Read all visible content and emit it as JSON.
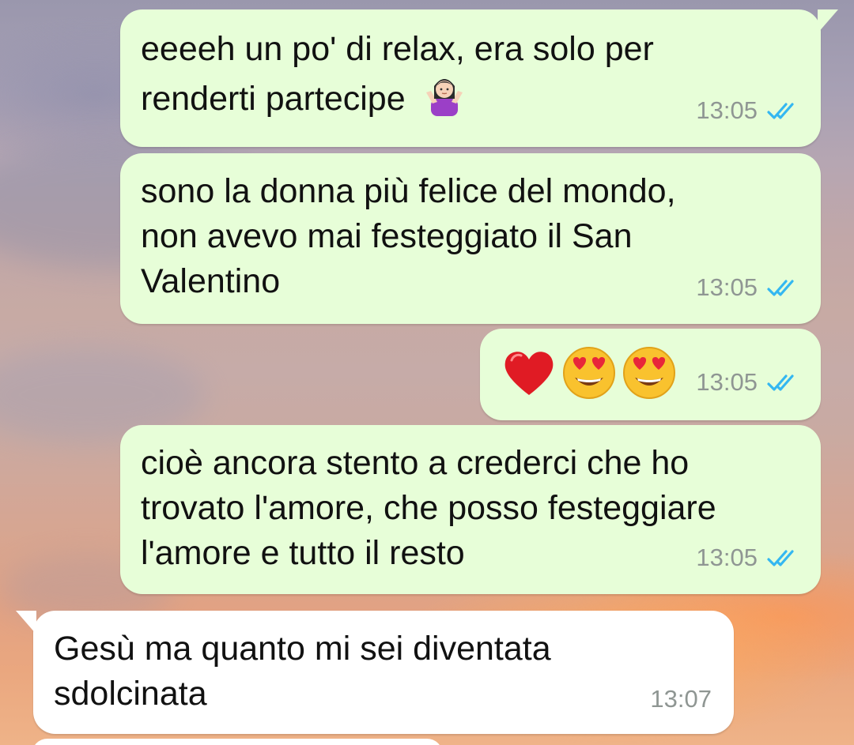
{
  "chat": {
    "messages": [
      {
        "direction": "outgoing",
        "lines": [
          "eeeeh un po' di relax, era solo per",
          "renderti partecipe"
        ],
        "trailing_emoji": "person-shrugging-emoji",
        "time": "13:05",
        "status": "read"
      },
      {
        "direction": "outgoing",
        "lines": [
          "sono la donna più felice del mondo,",
          "non avevo mai festeggiato il San",
          "Valentino"
        ],
        "time": "13:05",
        "status": "read"
      },
      {
        "direction": "outgoing",
        "lines": [],
        "emojis": [
          "red-heart-emoji",
          "heart-eyes-emoji",
          "heart-eyes-emoji"
        ],
        "time": "13:05",
        "status": "read"
      },
      {
        "direction": "outgoing",
        "lines": [
          "cioè ancora stento a crederci che ho",
          "trovato l'amore, che posso festeggiare",
          "l'amore e tutto il resto"
        ],
        "time": "13:05",
        "status": "read"
      },
      {
        "direction": "incoming",
        "lines": [
          "Gesù ma quanto mi sei diventata",
          "sdolcinata"
        ],
        "time": "13:07"
      }
    ]
  },
  "colors": {
    "outgoing_bubble": "#e7fed8",
    "incoming_bubble": "#ffffff",
    "read_ticks": "#34b7f1",
    "timestamp": "#8f9693"
  }
}
